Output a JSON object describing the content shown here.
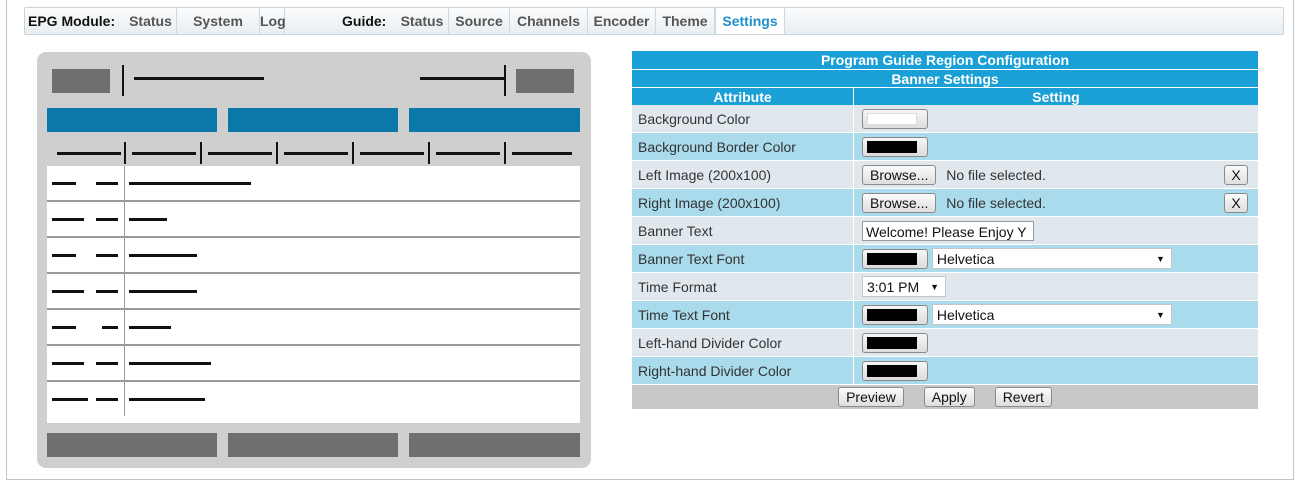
{
  "nav": {
    "epg_label": "EPG Module:",
    "epg_tabs": [
      "Status",
      "System",
      "Log"
    ],
    "guide_label": "Guide:",
    "guide_tabs": [
      "Status",
      "Source",
      "Channels",
      "Encoder",
      "Theme",
      "Settings"
    ],
    "active_tab": "Settings"
  },
  "config": {
    "title": "Program Guide Region Configuration",
    "section": "Banner Settings",
    "col_attribute": "Attribute",
    "col_setting": "Setting",
    "rows": {
      "background_color": {
        "label": "Background Color",
        "color": "#ffffff"
      },
      "background_border_color": {
        "label": "Background Border Color",
        "color": "#000000"
      },
      "left_image": {
        "label": "Left Image (200x100)",
        "browse": "Browse...",
        "status": "No file selected.",
        "clear": "X"
      },
      "right_image": {
        "label": "Right Image (200x100)",
        "browse": "Browse...",
        "status": "No file selected.",
        "clear": "X"
      },
      "banner_text": {
        "label": "Banner Text",
        "value": "Welcome! Please Enjoy Y"
      },
      "banner_text_font": {
        "label": "Banner Text Font",
        "color": "#000000",
        "font": "Helvetica"
      },
      "time_format": {
        "label": "Time Format",
        "value": "3:01 PM"
      },
      "time_text_font": {
        "label": "Time Text Font",
        "color": "#000000",
        "font": "Helvetica"
      },
      "left_divider_color": {
        "label": "Left-hand Divider Color",
        "color": "#000000"
      },
      "right_divider_color": {
        "label": "Right-hand Divider Color",
        "color": "#000000"
      }
    },
    "actions": {
      "preview": "Preview",
      "apply": "Apply",
      "revert": "Revert"
    }
  },
  "colors": {
    "accent": "#1a9fd6",
    "row_light": "#e0e8ee",
    "row_dark": "#a9dbec",
    "preview_blue": "#0a78a8"
  }
}
